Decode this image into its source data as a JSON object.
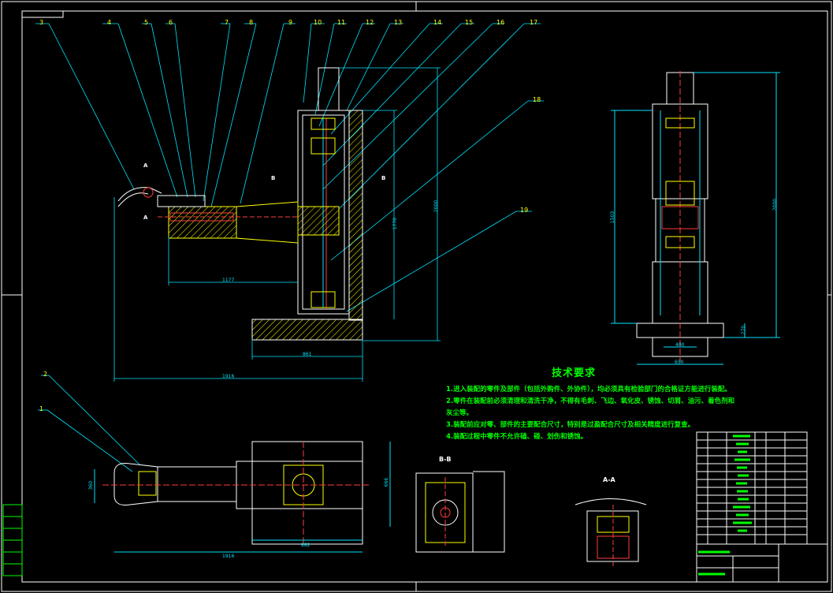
{
  "callouts": [
    "1",
    "2",
    "3",
    "4",
    "5",
    "6",
    "7",
    "8",
    "9",
    "10",
    "11",
    "12",
    "13",
    "14",
    "15",
    "16",
    "17",
    "18",
    "19"
  ],
  "section_views": {
    "bb": "B-B",
    "aa": "A-A"
  },
  "section_markers": {
    "a": "A",
    "b": "B"
  },
  "dimensions": {
    "d1177": "1177",
    "d1916_top": "1916",
    "d861": "861",
    "d1770": "1770",
    "d2000_top": "2000",
    "d400": "400",
    "d650": "650",
    "d1503": "1503",
    "d2000_right": "2000",
    "d270": "270",
    "d360": "360",
    "d882": "882",
    "d1916_bottom": "1916",
    "d666": "666"
  },
  "tech_requirements": {
    "title": "技术要求",
    "lines": [
      "1.进入装配的零件及部件（包括外购件、外协件），均必须具有检验部门的合格证方能进行装配。",
      "2.零件在装配前必须清理和清洗干净，不得有毛刺、飞边、氧化皮、锈蚀、切屑、油污、着色剂和",
      "灰尘等。",
      "3.装配前应对零、部件的主要配合尺寸，特别是过盈配合尺寸及相关精度进行复查。",
      "4.装配过程中零件不允许磕、碰、划伤和锈蚀。"
    ]
  },
  "colors": {
    "background": "#000000",
    "border": "#ffffff",
    "leader": "#00e5ff",
    "part": "#ffffff",
    "hatch": "#ffff00",
    "accent_red": "#ff3b3b",
    "text": "#00ff00"
  }
}
